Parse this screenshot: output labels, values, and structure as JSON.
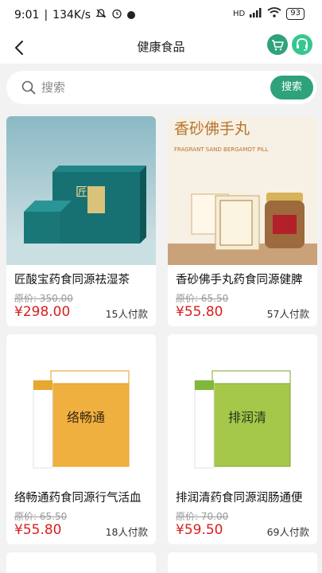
{
  "status_bar": {
    "time": "9:01",
    "speed": "134K/s",
    "network": "HD",
    "battery": "93"
  },
  "header": {
    "title": "健康食品"
  },
  "search": {
    "placeholder": "搜索",
    "button_label": "搜索"
  },
  "products": [
    {
      "name": "匠酸宝药食同源祛湿茶",
      "orig_label": "原价: 350.00",
      "price": "¥298.00",
      "sold": "15人付款",
      "image_text": "匠 酸 寶"
    },
    {
      "name": "香砂佛手丸药食同源健脾",
      "orig_label": "原价: 65.50",
      "price": "¥55.80",
      "sold": "57人付款",
      "image_text": "香砂佛手丸",
      "image_subtext": "FRAGRANT SAND BERGAMOT PILL"
    },
    {
      "name": "络畅通药食同源行气活血",
      "orig_label": "原价: 65.50",
      "price": "¥55.80",
      "sold": "18人付款",
      "image_text": "络畅通"
    },
    {
      "name": "排润清药食同源润肠通便",
      "orig_label": "原价: 70.00",
      "price": "¥59.50",
      "sold": "69人付款",
      "image_text": "排润清"
    }
  ],
  "colors": {
    "accent": "#2ea27b",
    "price": "#d81e1e",
    "background": "#f2f2f2"
  },
  "icons": [
    "back-arrow-icon",
    "cart-icon",
    "headset-icon",
    "search-icon"
  ]
}
